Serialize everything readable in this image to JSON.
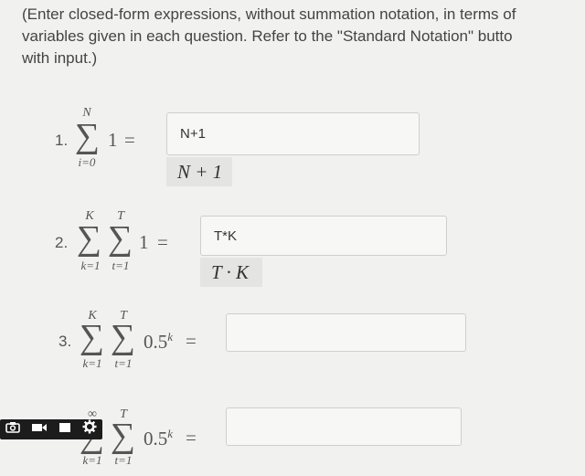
{
  "instructions": [
    "(Enter closed-form expressions, without summation notation, in terms of",
    "variables given in each question. Refer to the \"Standard Notation\" butto",
    "with input.)"
  ],
  "questions": [
    {
      "number": "1.",
      "sum_upper": "N",
      "sum_lower": "i=0",
      "term": "1",
      "equals": "=",
      "input_value": "N+1",
      "preview": "N + 1"
    },
    {
      "number": "2.",
      "sum1_upper": "K",
      "sum1_lower": "k=1",
      "sum2_upper": "T",
      "sum2_lower": "t=1",
      "term": "1",
      "equals": "=",
      "input_value": "T*K",
      "preview": "T · K"
    },
    {
      "number": "3.",
      "sum1_upper": "K",
      "sum1_lower": "k=1",
      "sum2_upper": "T",
      "sum2_lower": "t=1",
      "term_base": "0.5",
      "term_exp": "k",
      "equals": "=",
      "input_value": ""
    },
    {
      "sum1_upper": "∞",
      "sum1_lower": "k=1",
      "sum2_upper": "T",
      "sum2_lower": "t=1",
      "term_base": "0.5",
      "term_exp": "k",
      "equals": "=",
      "input_value": ""
    }
  ],
  "toolbar": {
    "icons": [
      "camera-icon",
      "video-icon",
      "square-icon",
      "gear-icon"
    ]
  }
}
